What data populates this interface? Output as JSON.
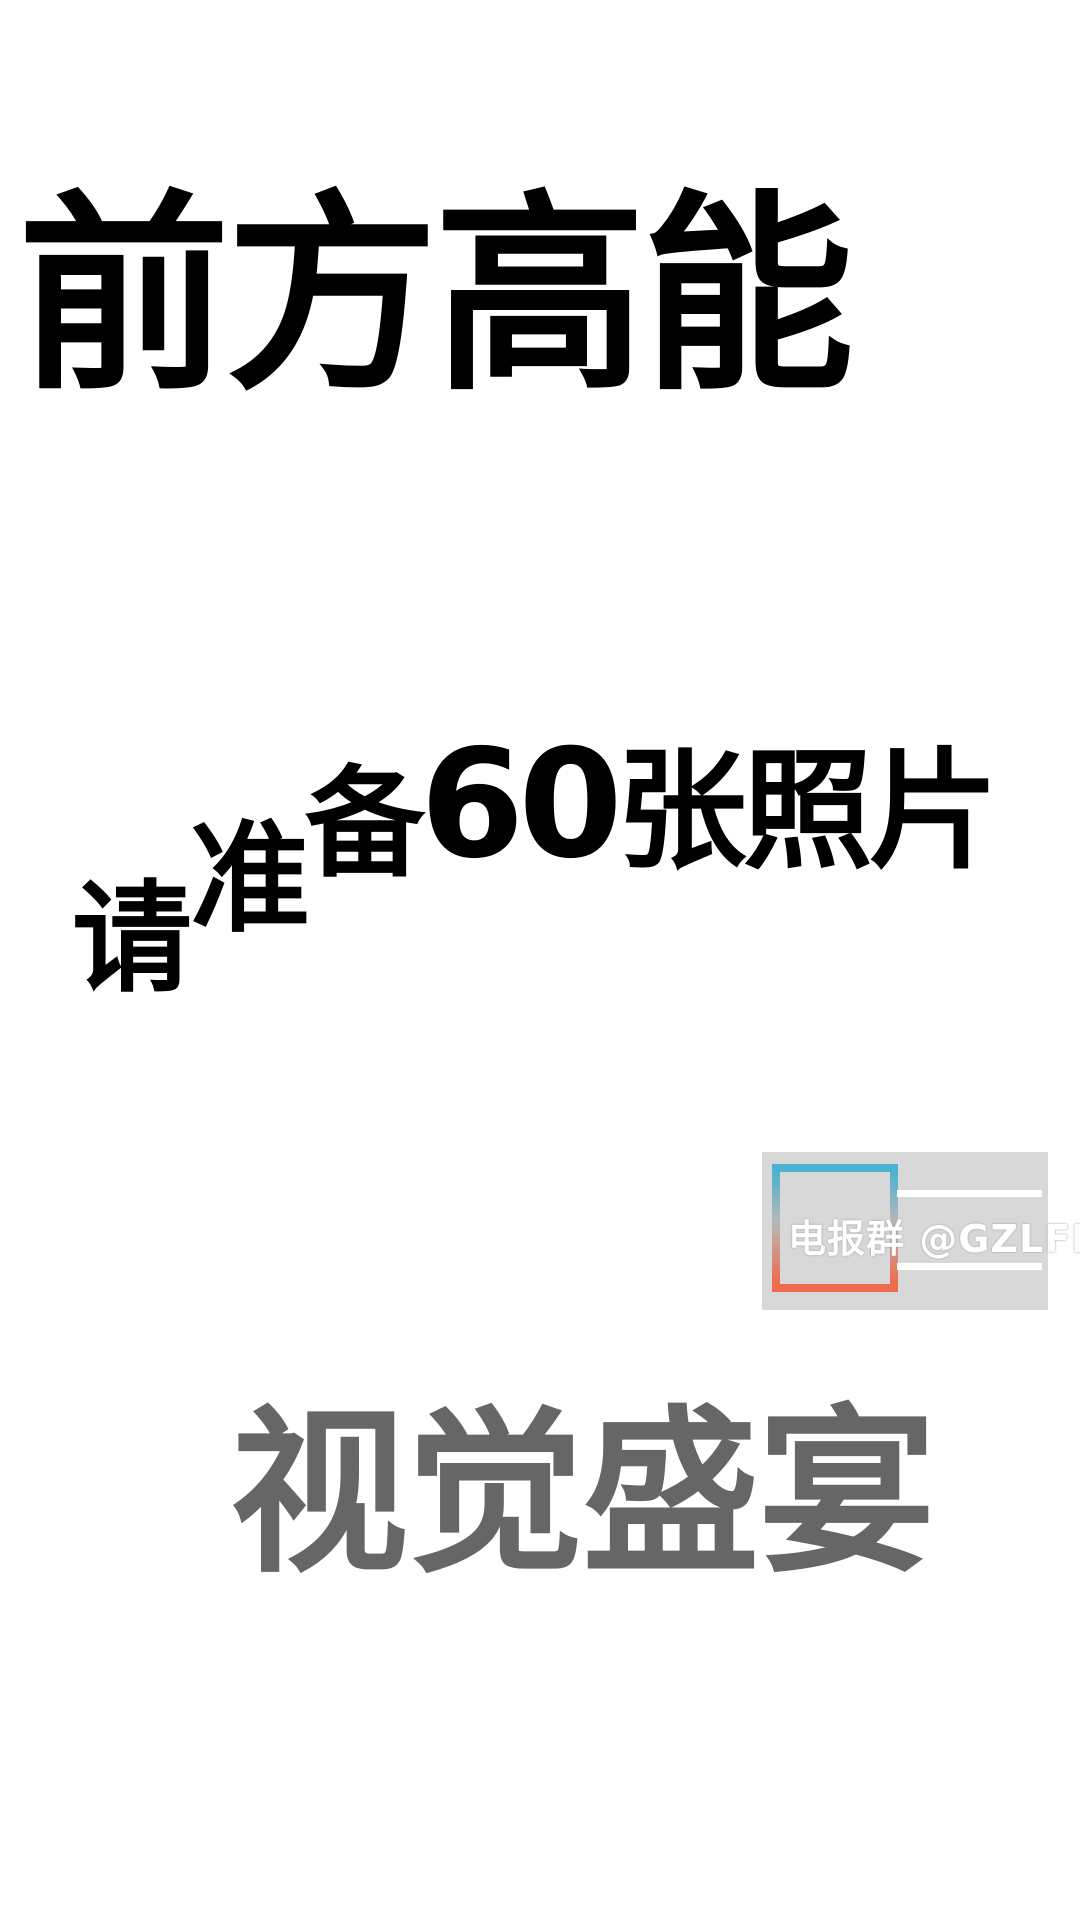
{
  "headline": "前方高能",
  "staircase": {
    "w1": "请",
    "w2": "准",
    "w3": "备",
    "number": "60",
    "rest": "张照片"
  },
  "watermark": {
    "text": "电报群 @GZLFL"
  },
  "subline": "视觉盛宴",
  "colors": {
    "headline": "#000000",
    "subline": "#666666",
    "watermark_bg": "#d8d8d8",
    "watermark_accent_top": "#49b3cf",
    "watermark_accent_bottom": "#ee6a4c"
  }
}
